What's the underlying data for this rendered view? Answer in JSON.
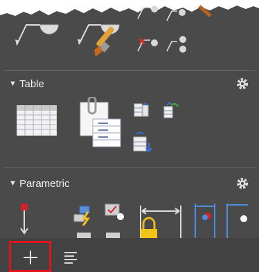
{
  "panel": {
    "sections": [
      {
        "label": "Table"
      },
      {
        "label": "Parametric"
      }
    ]
  },
  "colors": {
    "panel_background": "#4a4a4a",
    "bottom_bar": "#424242",
    "highlight_border": "#e0141b",
    "divider": "#6a6a6a"
  },
  "icons": {
    "top_row": [
      "multileader-icon",
      "multileader-style-icon",
      "add-leader-icon",
      "remove-leader-icon",
      "align-leaders-icon",
      "collect-leaders-icon"
    ],
    "table_section": [
      "table-icon",
      "extract-data-icon",
      "table-style-icon",
      "link-data-icon",
      "download-from-source-icon"
    ],
    "parametric_section": [
      "auto-constrain-icon",
      "infer-constraints-icon",
      "show-constraints-icon",
      "lock-dimension-icon",
      "dimensional-constraint-icon",
      "geometric-constraint-icon"
    ],
    "bottom_bar": [
      "add-icon",
      "list-view-icon"
    ]
  }
}
